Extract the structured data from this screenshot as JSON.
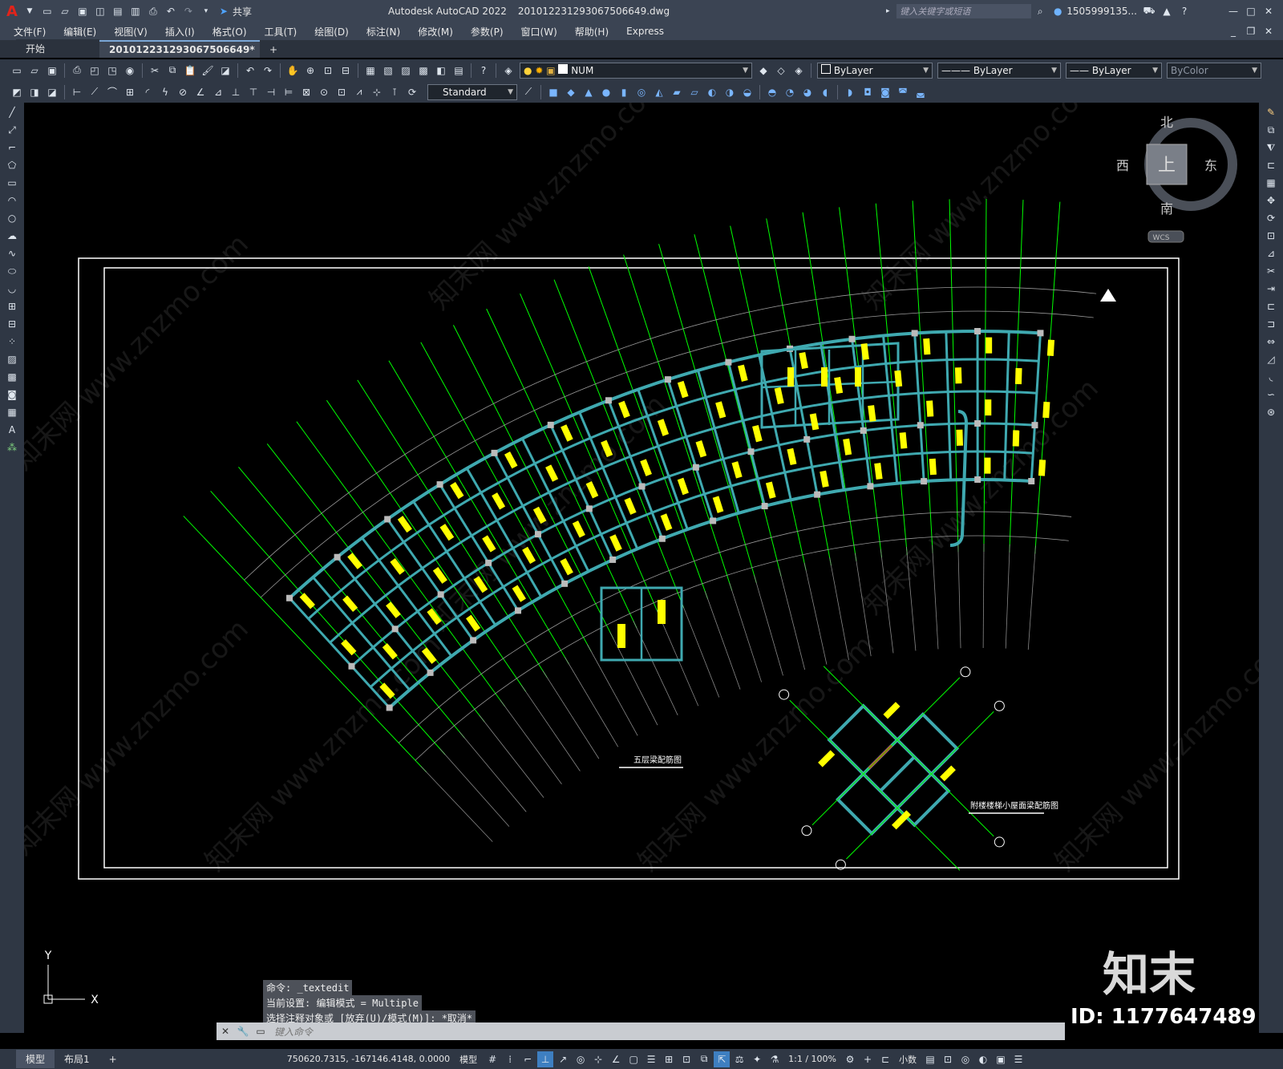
{
  "titlebar": {
    "logo": "A",
    "share_label": "共享",
    "app_title": "Autodesk AutoCAD 2022",
    "file_title": "201012231293067506649.dwg",
    "search_placeholder": "键入关键字或短语",
    "user": "1505999135...",
    "icons": [
      "new-icon",
      "open-icon",
      "save-icon",
      "saveas-icon",
      "plot-icon",
      "undo-icon",
      "redo-icon",
      "search-icon",
      "user-icon",
      "cart-icon",
      "help-icon",
      "minimize-icon",
      "maximize-icon",
      "close-icon"
    ]
  },
  "menu": [
    "文件(F)",
    "编辑(E)",
    "视图(V)",
    "插入(I)",
    "格式(O)",
    "工具(T)",
    "绘图(D)",
    "标注(N)",
    "修改(M)",
    "参数(P)",
    "窗口(W)",
    "帮助(H)",
    "Express"
  ],
  "tabs": {
    "start": "开始",
    "active": "201012231293067506649*",
    "add": "+"
  },
  "toolbar": {
    "layer_value": "NUM",
    "color_value": "ByLayer",
    "linetype_value": "ByLayer",
    "lineweight_value": "ByLayer",
    "plotstyle_value": "ByColor",
    "textstyle_value": "Standard"
  },
  "viewcube": {
    "north": "北",
    "south": "南",
    "east": "东",
    "west": "西",
    "top": "上",
    "wcs": "WCS"
  },
  "drawing": {
    "title_main": "五层梁配筋图",
    "title_sub": "附楼楼梯小屋面梁配筋图"
  },
  "ucs": {
    "x": "X",
    "y": "Y"
  },
  "command": {
    "line1": "命令: _textedit",
    "line2": "当前设置: 编辑模式 = Multiple",
    "line3": "选择注释对象或 [放弃(U)/模式(M)]: *取消*",
    "placeholder": "键入命令"
  },
  "watermark": {
    "brand": "知末",
    "id": "ID: 1177647489",
    "site": "知末网 www.znzmo.com"
  },
  "status": {
    "model_tab": "模型",
    "layout_tab": "布局1",
    "add": "+",
    "coords": "750620.7315, -167146.4148, 0.0000",
    "mode": "模型",
    "scale": "1:1 / 100%",
    "units": "小数"
  },
  "colors": {
    "beam": "#3fa9b0",
    "text": "#ffff00",
    "axis": "#00ff00",
    "frame": "#ffffff",
    "chrome": "#3b4453"
  }
}
